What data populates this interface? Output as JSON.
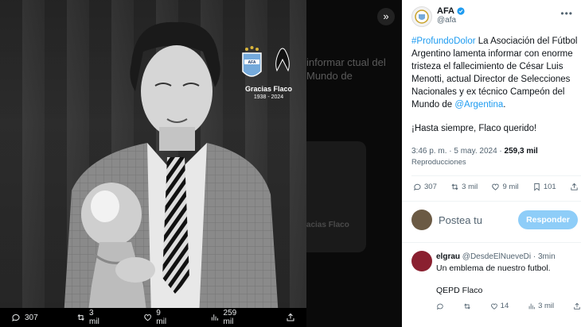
{
  "viewer": {
    "badge_caption": "Gracias Flaco",
    "badge_years": "1938 - 2024",
    "ghost_text": "informar ctual del Mundo de",
    "ghost_card_text": "racias Flaco",
    "actions": {
      "replies": "307",
      "reposts": "3 mil",
      "likes": "9 mil",
      "views": "259 mil"
    }
  },
  "tweet": {
    "author_name": "AFA",
    "author_handle": "@afa",
    "hashtag": "#ProfundoDolor",
    "text_part1": " La Asociación del Fútbol Argentino lamenta informar con enorme tristeza el fallecimiento de César Luis Menotti, actual Director de Selecciones Nacionales y ex técnico Campeón del Mundo de ",
    "mention": "@Argentina",
    "text_part2": ".",
    "text_para2": "¡Hasta siempre, Flaco querido!",
    "time": "3:46 p. m. · 5 may. 2024 · ",
    "views": "259,3 mil",
    "views_label": "Reproducciones",
    "stats": {
      "replies": "307",
      "reposts": "3 mil",
      "likes": "9 mil",
      "bookmarks": "101"
    }
  },
  "compose": {
    "placeholder": "Postea tu",
    "button": "Responder"
  },
  "reply": {
    "name": "elgrau",
    "handle": "@DesdeElNueveDi · 3min",
    "line1": "Un emblema de nuestro futbol.",
    "line2": "QEPD Flaco",
    "likes": "14",
    "views": "3 mil"
  },
  "colors": {
    "accent": "#1d9bf0",
    "reply_button": "#8ecdf8",
    "muted": "#536471"
  }
}
